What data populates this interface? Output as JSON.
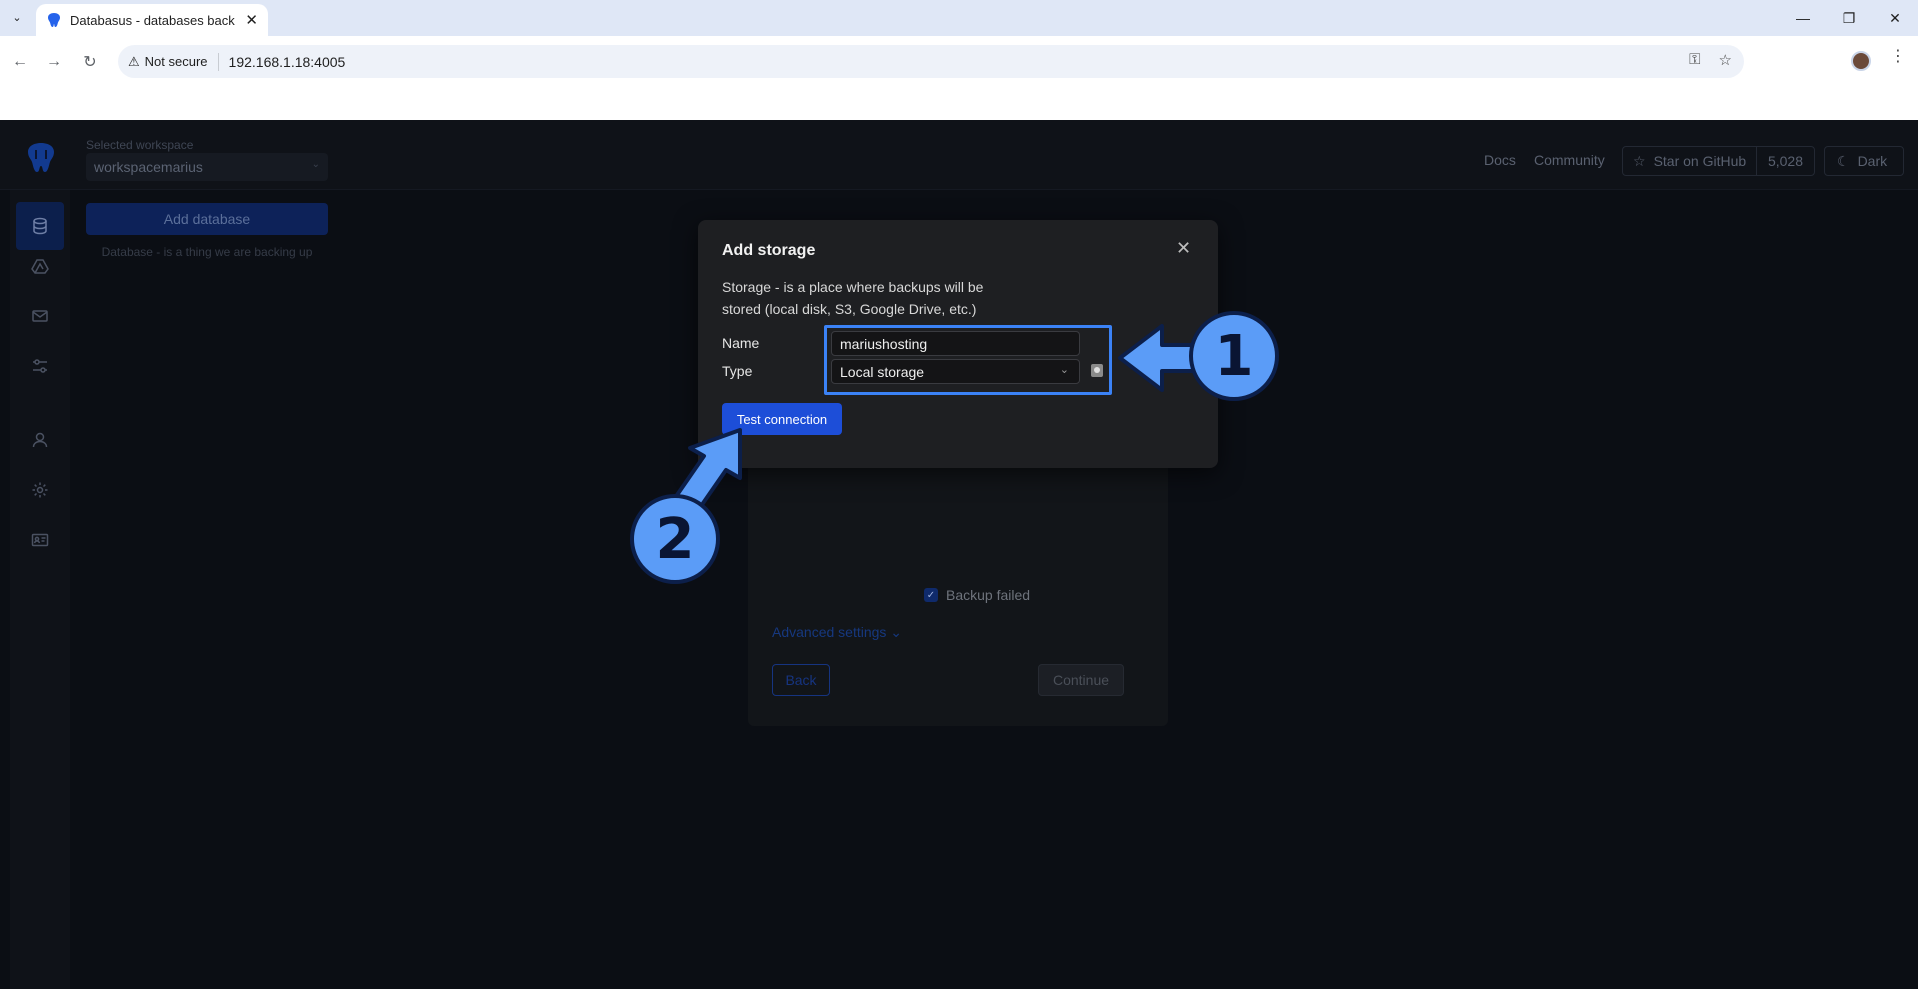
{
  "browser": {
    "tab_title": "Databasus - databases backups",
    "security_label": "Not secure",
    "url": "192.168.1.18:4005"
  },
  "header": {
    "workspace_label": "Selected workspace",
    "workspace_value": "workspacemarius",
    "docs_link": "Docs",
    "community_link": "Community",
    "github_button": "Star on GitHub",
    "github_stars": "5,028",
    "theme_button": "Dark"
  },
  "sidebar": {
    "items": [
      {
        "name": "databases",
        "icon": "database-icon"
      },
      {
        "name": "storages",
        "icon": "cloud-drive-icon"
      },
      {
        "name": "notifiers",
        "icon": "mail-icon"
      },
      {
        "name": "settings",
        "icon": "sliders-icon"
      },
      {
        "name": "users",
        "icon": "user-icon"
      },
      {
        "name": "preferences",
        "icon": "gear-icon"
      },
      {
        "name": "profile",
        "icon": "id-card-icon"
      }
    ]
  },
  "main": {
    "add_database_label": "Add database",
    "add_database_hint": "Database - is a thing we are backing up"
  },
  "background_form": {
    "backup_failed_label": "Backup failed",
    "advanced_settings_label": "Advanced settings",
    "back_label": "Back",
    "continue_label": "Continue"
  },
  "modal": {
    "title": "Add storage",
    "description": "Storage - is a place where backups will be stored (local disk, S3, Google Drive, etc.)",
    "name_label": "Name",
    "name_value": "mariushosting",
    "type_label": "Type",
    "type_value": "Local storage",
    "test_connection_label": "Test connection"
  },
  "annotations": {
    "badge_1": "1",
    "badge_2": "2",
    "color": "#5b9cf7"
  }
}
